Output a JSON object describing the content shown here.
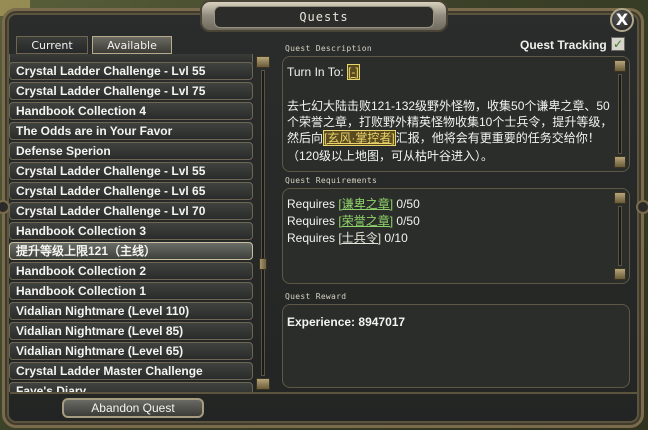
{
  "window": {
    "title": "Quests",
    "close_label": "X"
  },
  "tabs": [
    {
      "label": "Current"
    },
    {
      "label": "Available"
    }
  ],
  "quest_list": [
    {
      "label": "Crystal Ladder Challenge - Lvl 55"
    },
    {
      "label": "Crystal Ladder Challenge - Lvl 75"
    },
    {
      "label": "Handbook Collection 4"
    },
    {
      "label": "The Odds are in Your Favor"
    },
    {
      "label": "Defense Sperion"
    },
    {
      "label": "Crystal Ladder Challenge - Lvl 55"
    },
    {
      "label": "Crystal Ladder Challenge - Lvl 65"
    },
    {
      "label": "Crystal Ladder Challenge - Lvl 70"
    },
    {
      "label": "Handbook Collection 3"
    },
    {
      "label": "提升等级上限121（主线）"
    },
    {
      "label": "Handbook Collection 2"
    },
    {
      "label": "Handbook Collection 1"
    },
    {
      "label": "Vidalian Nightmare (Level 110)"
    },
    {
      "label": "Vidalian Nightmare (Level 85)"
    },
    {
      "label": "Vidalian Nightmare (Level 65)"
    },
    {
      "label": "Crystal Ladder Master Challenge"
    },
    {
      "label": "Faye's Diary"
    }
  ],
  "selected_index": 9,
  "quest_tracking": {
    "label": "Quest Tracking",
    "checked": true
  },
  "description": {
    "section_label": "Quest Description",
    "turn_in_prefix": "Turn In To:",
    "turn_in_link": "[-]",
    "line1": "去七幻大陆击败121-132级野外怪物，收集50个谦卑之章、50",
    "line2": "个荣誉之章，打败野外精英怪物收集10个士兵令，提升等级，",
    "line3_pre": "然后向",
    "line3_link": "[玄风·掌控者]",
    "line3_post": "汇报，他将会有更重要的任务交给你！",
    "line4": "（120级以上地图，可从枯叶谷进入）。"
  },
  "requirements": {
    "section_label": "Quest Requirements",
    "items": [
      {
        "prefix": "Requires",
        "item": "[谦卑之章]",
        "count": "0/50"
      },
      {
        "prefix": "Requires",
        "item": "[荣誉之章]",
        "count": "0/50"
      },
      {
        "prefix": "Requires",
        "item": "[士兵令]",
        "count": "0/10"
      }
    ]
  },
  "rewards": {
    "section_label": "Quest Reward",
    "experience_label": "Experience:",
    "experience_value": "8947017"
  },
  "abandon_label": "Abandon Quest",
  "colors": {
    "frame": "#7a6b4c",
    "link": "#e8d46a",
    "link_green": "#8fd46a"
  }
}
